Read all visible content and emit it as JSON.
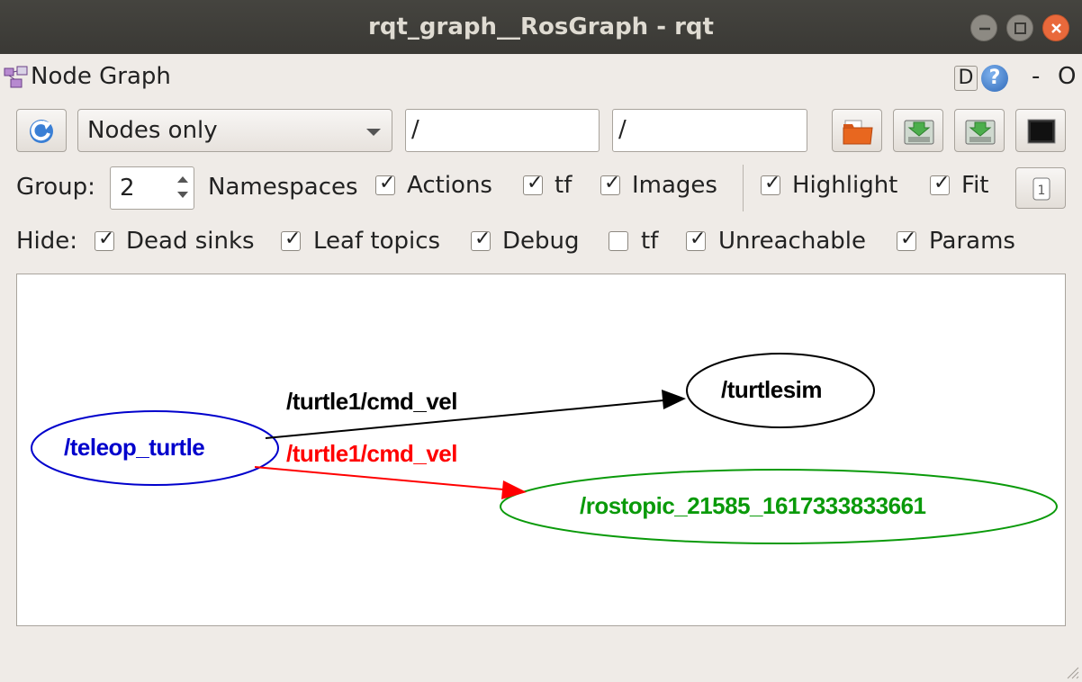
{
  "window": {
    "title": "rqt_graph__RosGraph - rqt"
  },
  "plugin": {
    "title": "Node Graph",
    "d_label": "D",
    "help_label": "?",
    "dash_label": "-",
    "o_label": "O"
  },
  "toolbar": {
    "view_mode": "Nodes only",
    "node_filter": "/",
    "topic_filter": "/"
  },
  "options": {
    "group_label": "Group:",
    "group_value": "2",
    "namespaces_label": "Namespaces",
    "actions_label": "Actions",
    "tf_label": "tf",
    "images_label": "Images",
    "highlight_label": "Highlight",
    "fit_label": "Fit",
    "checked": {
      "namespaces": true,
      "actions": true,
      "tf": true,
      "images": true,
      "highlight": true,
      "fit": true
    }
  },
  "hide": {
    "hide_label": "Hide:",
    "dead_sinks_label": "Dead sinks",
    "leaf_topics_label": "Leaf topics",
    "debug_label": "Debug",
    "tf_label": "tf",
    "unreachable_label": "Unreachable",
    "params_label": "Params",
    "checked": {
      "dead_sinks": true,
      "leaf_topics": true,
      "debug": true,
      "tf": false,
      "unreachable": true,
      "params": true
    }
  },
  "graph": {
    "nodes": {
      "teleop": "/teleop_turtle",
      "turtlesim": "/turtlesim",
      "rostopic": "/rostopic_21585_1617333833661"
    },
    "edges": {
      "edge1_label": "/turtle1/cmd_vel",
      "edge2_label": "/turtle1/cmd_vel"
    },
    "colors": {
      "teleop": "#0000cc",
      "turtlesim": "#000000",
      "rostopic": "#0a9a0a",
      "edge_black": "#000000",
      "edge_red": "#ff0000"
    }
  }
}
